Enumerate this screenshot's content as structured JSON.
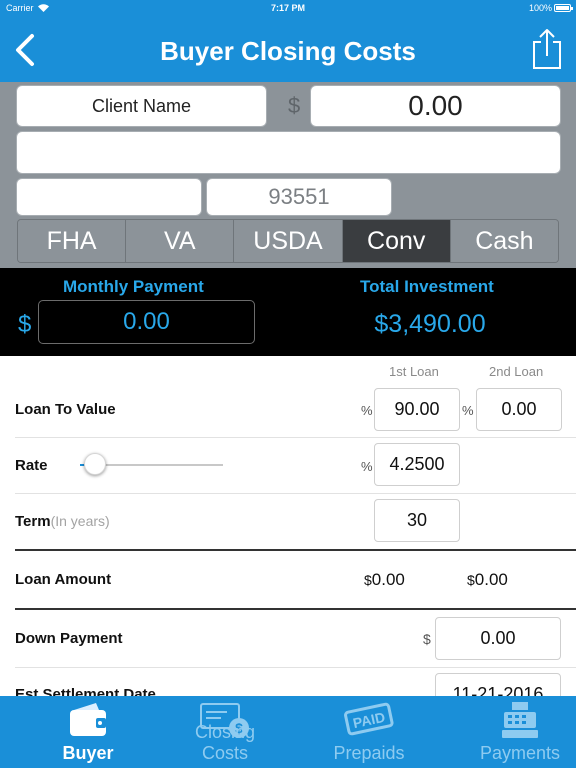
{
  "status_bar": {
    "carrier": "Carrier",
    "time": "7:17 PM",
    "battery": "100%"
  },
  "nav": {
    "title": "Buyer Closing Costs",
    "back_icon": "chevron-left-icon",
    "share_icon": "share-icon"
  },
  "client": {
    "client_name_placeholder": "Client Name",
    "currency_symbol": "$",
    "purchase_price": "0.00",
    "address": "",
    "city": "",
    "zip": "93551"
  },
  "loan_types": {
    "items": [
      "FHA",
      "VA",
      "USDA",
      "Conv",
      "Cash"
    ],
    "selected": "Conv"
  },
  "summary": {
    "monthly_label": "Monthly Payment",
    "monthly_currency": "$",
    "monthly_value": "0.00",
    "investment_label": "Total Investment",
    "investment_value": "$3,490.00"
  },
  "form": {
    "col_first": "1st Loan",
    "col_second": "2nd Loan",
    "ltv": {
      "label": "Loan To Value",
      "pct": "%",
      "first": "90.00",
      "second": "0.00"
    },
    "rate": {
      "label": "Rate",
      "pct": "%",
      "value": "4.2500",
      "slider_level": 0.08
    },
    "term": {
      "label": "Term",
      "hint": "(In years)",
      "value": "30"
    },
    "loan_amount": {
      "label": "Loan Amount",
      "currency": "$",
      "first": "0.00",
      "second": "0.00"
    },
    "down_payment": {
      "label": "Down Payment",
      "currency": "$",
      "value": "0.00"
    },
    "settlement": {
      "label": "Est Settlement Date",
      "value": "11-21-2016"
    }
  },
  "tabs": [
    {
      "label": "Buyer",
      "icon": "wallet-icon",
      "active": true
    },
    {
      "label": "Closing Costs",
      "icon": "check-dollar-icon",
      "active": false
    },
    {
      "label": "Prepaids",
      "icon": "paid-stamp-icon",
      "active": false
    },
    {
      "label": "Payments",
      "icon": "cash-register-icon",
      "active": false
    }
  ],
  "colors": {
    "brand": "#1a8fd8",
    "accent_text": "#29a8ea",
    "panel_grey": "#8c9399",
    "selected_segment": "#3a3d40"
  }
}
